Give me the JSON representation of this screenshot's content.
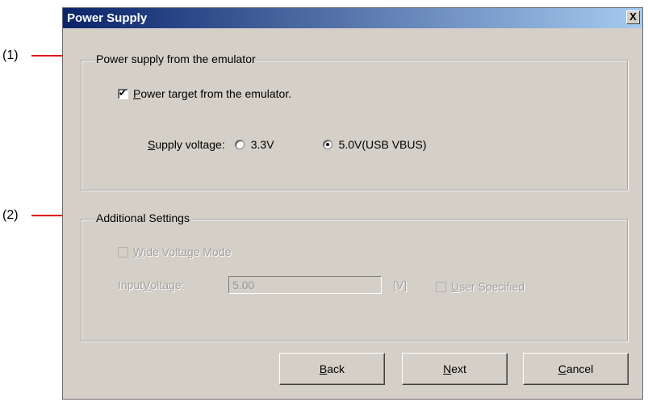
{
  "callouts": [
    "(1)",
    "(2)"
  ],
  "dialog": {
    "title": "Power Supply",
    "close_label": "X"
  },
  "group1": {
    "legend": "Power supply from the emulator",
    "power_target": {
      "label_first": "P",
      "label_rest": "ower target from the emulator.",
      "checked": true
    },
    "supply_voltage": {
      "label_first": "S",
      "label_rest": "upply voltage:",
      "options": [
        "3.3V",
        "5.0V(USB VBUS)"
      ],
      "selected": "5.0V(USB VBUS)"
    }
  },
  "group2": {
    "legend": "Additional Settings",
    "wide_voltage": {
      "label_first": "W",
      "label_rest": "ide Voltage Mode",
      "checked": false,
      "enabled": false
    },
    "input_voltage": {
      "label_prefix": "Input ",
      "label_first": "V",
      "label_rest": "oltage:",
      "value": "5.00",
      "unit": "[V]"
    },
    "user_specified": {
      "label_first": "U",
      "label_rest": "ser Specified",
      "checked": false,
      "enabled": false
    }
  },
  "buttons": {
    "back": {
      "first": "B",
      "rest": "ack"
    },
    "next": {
      "first": "N",
      "rest": "ext"
    },
    "cancel": {
      "first": "C",
      "rest": "ancel"
    }
  },
  "colors": {
    "dialog_bg": "#d4d0c8",
    "title_start": "#0a246a",
    "title_end": "#a6caf0",
    "callout_arrow": "#e00000"
  }
}
